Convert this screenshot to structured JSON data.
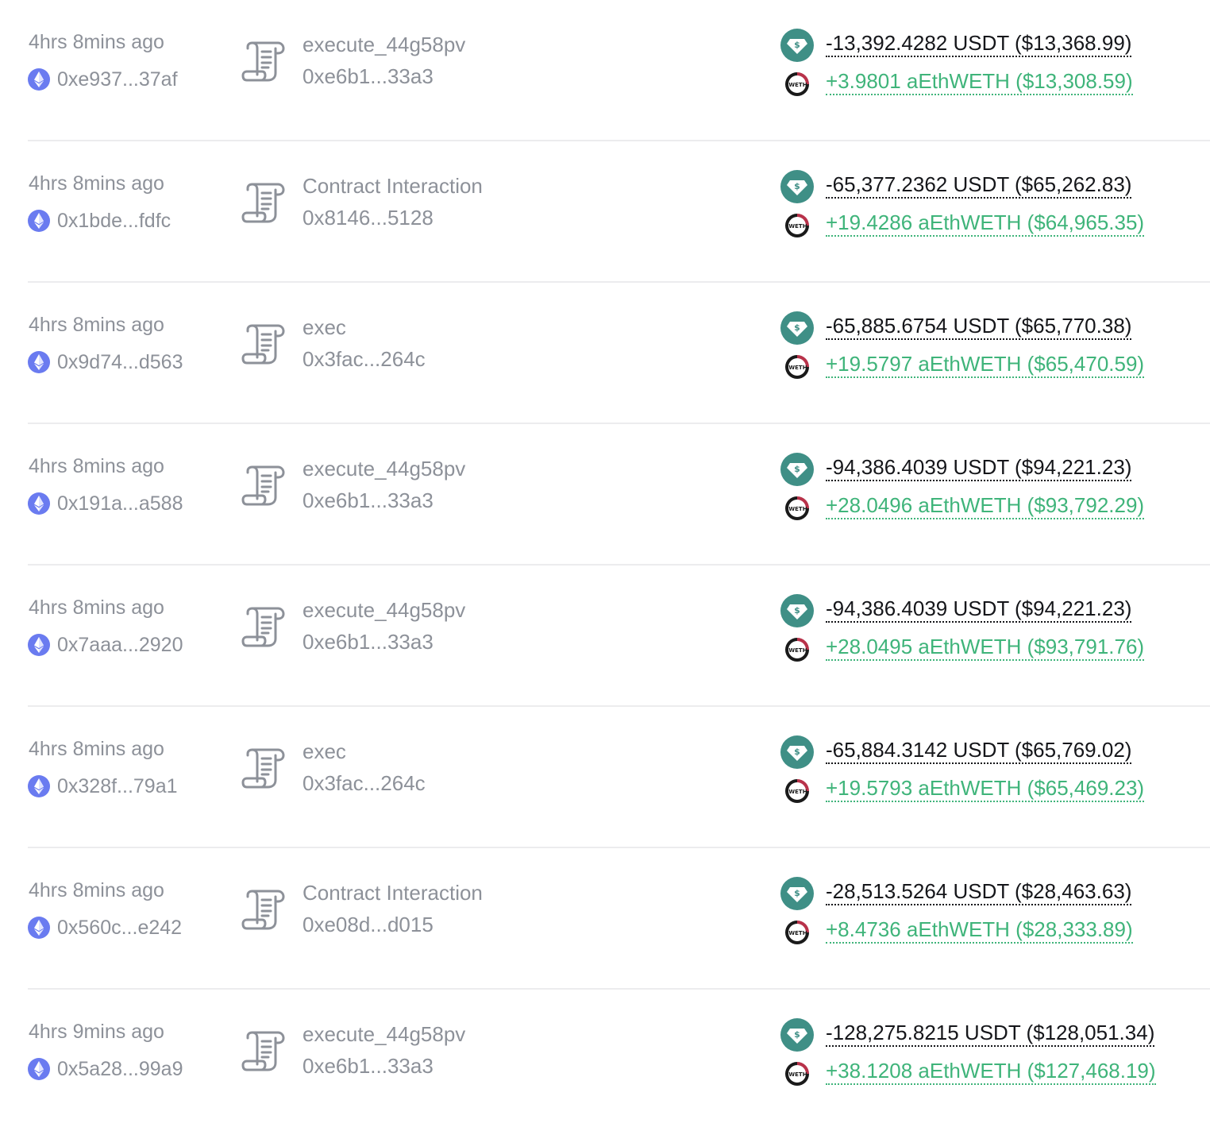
{
  "colors": {
    "muted_text": "#8d9199",
    "negative_amount": "#15161a",
    "positive_amount": "#3fb47a",
    "usdt_badge": "#3f8f86",
    "eth_badge": "#6a7bf0",
    "divider": "#ececee"
  },
  "icons": {
    "chain": "ethereum-icon",
    "method": "contract-scroll-icon",
    "out_token": "usdt-token-icon",
    "in_token": "weth-token-icon"
  },
  "transactions": [
    {
      "time": "4hrs 8mins ago",
      "from": "0xe937...37af",
      "method": "execute_44g58pv",
      "contract": "0xe6b1...33a3",
      "out_amount": "-13,392.4282 USDT ($13,368.99)",
      "in_amount": "+3.9801 aEthWETH ($13,308.59)"
    },
    {
      "time": "4hrs 8mins ago",
      "from": "0x1bde...fdfc",
      "method": "Contract Interaction",
      "contract": "0x8146...5128",
      "out_amount": "-65,377.2362 USDT ($65,262.83)",
      "in_amount": "+19.4286 aEthWETH ($64,965.35)"
    },
    {
      "time": "4hrs 8mins ago",
      "from": "0x9d74...d563",
      "method": "exec",
      "contract": "0x3fac...264c",
      "out_amount": "-65,885.6754 USDT ($65,770.38)",
      "in_amount": "+19.5797 aEthWETH ($65,470.59)"
    },
    {
      "time": "4hrs 8mins ago",
      "from": "0x191a...a588",
      "method": "execute_44g58pv",
      "contract": "0xe6b1...33a3",
      "out_amount": "-94,386.4039 USDT ($94,221.23)",
      "in_amount": "+28.0496 aEthWETH ($93,792.29)"
    },
    {
      "time": "4hrs 8mins ago",
      "from": "0x7aaa...2920",
      "method": "execute_44g58pv",
      "contract": "0xe6b1...33a3",
      "out_amount": "-94,386.4039 USDT ($94,221.23)",
      "in_amount": "+28.0495 aEthWETH ($93,791.76)"
    },
    {
      "time": "4hrs 8mins ago",
      "from": "0x328f...79a1",
      "method": "exec",
      "contract": "0x3fac...264c",
      "out_amount": "-65,884.3142 USDT ($65,769.02)",
      "in_amount": "+19.5793 aEthWETH ($65,469.23)"
    },
    {
      "time": "4hrs 8mins ago",
      "from": "0x560c...e242",
      "method": "Contract Interaction",
      "contract": "0xe08d...d015",
      "out_amount": "-28,513.5264 USDT ($28,463.63)",
      "in_amount": "+8.4736 aEthWETH ($28,333.89)"
    },
    {
      "time": "4hrs 9mins ago",
      "from": "0x5a28...99a9",
      "method": "execute_44g58pv",
      "contract": "0xe6b1...33a3",
      "out_amount": "-128,275.8215 USDT ($128,051.34)",
      "in_amount": "+38.1208 aEthWETH ($127,468.19)"
    }
  ]
}
